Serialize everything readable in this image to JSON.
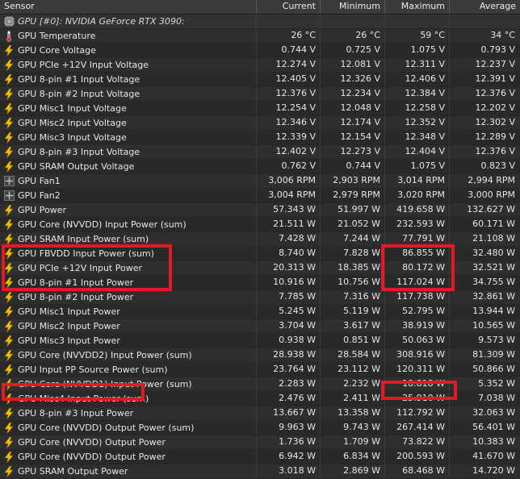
{
  "header": {
    "sensor": "Sensor",
    "current": "Current",
    "minimum": "Minimum",
    "maximum": "Maximum",
    "average": "Average"
  },
  "group": {
    "label": "GPU [#0]: NVIDIA GeForce RTX 3090:",
    "icon": "gpu-chip-icon"
  },
  "colors": {
    "highlight": "#e01b24",
    "bolt": "#f2c200",
    "thermometer": "#c8d6e6",
    "fan": "#bbbbbb"
  },
  "rows": [
    {
      "name": "GPU Temperature",
      "icon": "thermometer-icon",
      "current": "26 °C",
      "min": "26 °C",
      "max": "59 °C",
      "avg": "34 °C"
    },
    {
      "name": "GPU Core Voltage",
      "icon": "bolt-icon",
      "current": "0.744 V",
      "min": "0.725 V",
      "max": "1.075 V",
      "avg": "0.793 V"
    },
    {
      "name": "GPU PCIe +12V Input Voltage",
      "icon": "bolt-icon",
      "current": "12.274 V",
      "min": "12.081 V",
      "max": "12.311 V",
      "avg": "12.237 V"
    },
    {
      "name": "GPU 8-pin #1 Input Voltage",
      "icon": "bolt-icon",
      "current": "12.405 V",
      "min": "12.326 V",
      "max": "12.406 V",
      "avg": "12.391 V"
    },
    {
      "name": "GPU 8-pin #2 Input Voltage",
      "icon": "bolt-icon",
      "current": "12.376 V",
      "min": "12.234 V",
      "max": "12.384 V",
      "avg": "12.376 V"
    },
    {
      "name": "GPU Misc1 Input Voltage",
      "icon": "bolt-icon",
      "current": "12.254 V",
      "min": "12.048 V",
      "max": "12.258 V",
      "avg": "12.202 V"
    },
    {
      "name": "GPU Misc2 Input Voltage",
      "icon": "bolt-icon",
      "current": "12.346 V",
      "min": "12.174 V",
      "max": "12.352 V",
      "avg": "12.302 V"
    },
    {
      "name": "GPU Misc3 Input Voltage",
      "icon": "bolt-icon",
      "current": "12.339 V",
      "min": "12.154 V",
      "max": "12.348 V",
      "avg": "12.289 V"
    },
    {
      "name": "GPU 8-pin #3 Input Voltage",
      "icon": "bolt-icon",
      "current": "12.402 V",
      "min": "12.273 V",
      "max": "12.404 V",
      "avg": "12.376 V"
    },
    {
      "name": "GPU SRAM Output Voltage",
      "icon": "bolt-icon",
      "current": "0.762 V",
      "min": "0.744 V",
      "max": "1.075 V",
      "avg": "0.823 V"
    },
    {
      "name": "GPU Fan1",
      "icon": "fan-icon",
      "current": "3,006 RPM",
      "min": "2,903 RPM",
      "max": "3,014 RPM",
      "avg": "2,994 RPM"
    },
    {
      "name": "GPU Fan2",
      "icon": "fan-icon",
      "current": "3,004 RPM",
      "min": "2,979 RPM",
      "max": "3,020 RPM",
      "avg": "3,000 RPM"
    },
    {
      "name": "GPU Power",
      "icon": "bolt-icon",
      "current": "57.343 W",
      "min": "51.997 W",
      "max": "419.658 W",
      "avg": "132.627 W"
    },
    {
      "name": "GPU Core (NVVDD) Input Power (sum)",
      "icon": "bolt-icon",
      "current": "21.511 W",
      "min": "21.052 W",
      "max": "232.593 W",
      "avg": "60.171 W"
    },
    {
      "name": "GPU SRAM Input Power (sum)",
      "icon": "bolt-icon",
      "current": "7.428 W",
      "min": "7.244 W",
      "max": "77.791 W",
      "avg": "21.108 W"
    },
    {
      "name": "GPU FBVDD Input Power (sum)",
      "icon": "bolt-icon",
      "current": "8.740 W",
      "min": "7.828 W",
      "max": "86.855 W",
      "avg": "32.480 W"
    },
    {
      "name": "GPU PCIe +12V Input Power",
      "icon": "bolt-icon",
      "current": "20.313 W",
      "min": "18.385 W",
      "max": "80.172 W",
      "avg": "32.521 W"
    },
    {
      "name": "GPU 8-pin #1 Input Power",
      "icon": "bolt-icon",
      "current": "10.916 W",
      "min": "10.756 W",
      "max": "117.024 W",
      "avg": "34.755 W"
    },
    {
      "name": "GPU 8-pin #2 Input Power",
      "icon": "bolt-icon",
      "current": "7.785 W",
      "min": "7.316 W",
      "max": "117.738 W",
      "avg": "32.861 W"
    },
    {
      "name": "GPU Misc1 Input Power",
      "icon": "bolt-icon",
      "current": "5.245 W",
      "min": "5.119 W",
      "max": "52.795 W",
      "avg": "13.944 W"
    },
    {
      "name": "GPU Misc2 Input Power",
      "icon": "bolt-icon",
      "current": "3.704 W",
      "min": "3.617 W",
      "max": "38.919 W",
      "avg": "10.565 W"
    },
    {
      "name": "GPU Misc3 Input Power",
      "icon": "bolt-icon",
      "current": "0.938 W",
      "min": "0.851 W",
      "max": "50.063 W",
      "avg": "9.573 W"
    },
    {
      "name": "GPU Core (NVVDD2) Input Power (sum)",
      "icon": "bolt-icon",
      "current": "28.938 W",
      "min": "28.584 W",
      "max": "308.916 W",
      "avg": "81.309 W"
    },
    {
      "name": "GPU Input PP Source Power (sum)",
      "icon": "bolt-icon",
      "current": "23.764 W",
      "min": "23.112 W",
      "max": "120.311 W",
      "avg": "50.866 W"
    },
    {
      "name": "GPU Core (NVVDD1) Input Power (sum)",
      "icon": "bolt-icon",
      "current": "2.283 W",
      "min": "2.232 W",
      "max": "18.818 W",
      "avg": "5.352 W"
    },
    {
      "name": "GPU Misc4 Input Power (sum)",
      "icon": "bolt-icon",
      "current": "2.476 W",
      "min": "2.411 W",
      "max": "25.910 W",
      "avg": "7.038 W"
    },
    {
      "name": "GPU 8-pin #3 Input Power",
      "icon": "bolt-icon",
      "current": "13.667 W",
      "min": "13.358 W",
      "max": "112.792 W",
      "avg": "32.063 W"
    },
    {
      "name": "GPU Core (NVVDD) Output Power (sum)",
      "icon": "bolt-icon",
      "current": "9.963 W",
      "min": "9.743 W",
      "max": "267.414 W",
      "avg": "56.401 W"
    },
    {
      "name": "GPU Core (NVVDD) Output Power",
      "icon": "bolt-icon",
      "current": "1.736 W",
      "min": "1.709 W",
      "max": "73.822 W",
      "avg": "10.383 W"
    },
    {
      "name": "GPU Core (NVVDD) Output Power",
      "icon": "bolt-icon",
      "current": "6.942 W",
      "min": "6.834 W",
      "max": "200.593 W",
      "avg": "41.670 W"
    },
    {
      "name": "GPU SRAM Output Power",
      "icon": "bolt-icon",
      "current": "3.018 W",
      "min": "2.869 W",
      "max": "68.468 W",
      "avg": "14.720 W"
    }
  ]
}
